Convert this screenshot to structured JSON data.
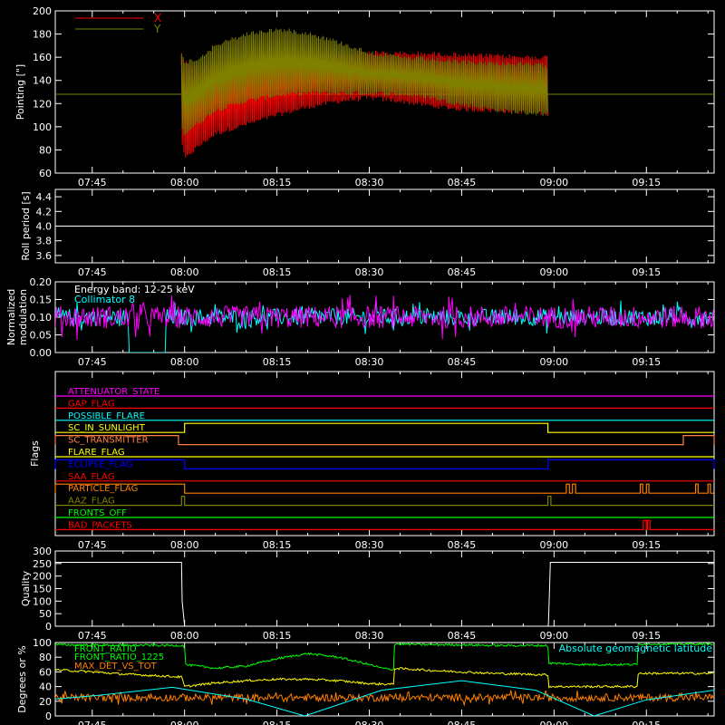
{
  "time_ticks": [
    "07:45",
    "08:00",
    "08:15",
    "08:30",
    "08:45",
    "09:00",
    "09:15"
  ],
  "time_tick_minutes": [
    465,
    480,
    495,
    510,
    525,
    540,
    555
  ],
  "time_range_minutes": [
    459,
    566
  ],
  "chart_data": [
    {
      "type": "line",
      "ylabel": "Pointing [\"]",
      "ylim": [
        60,
        200
      ],
      "yticks": [
        60,
        80,
        100,
        120,
        140,
        160,
        180,
        200
      ],
      "reference_line": 128,
      "legend": {
        "placement": "top-left"
      },
      "series": [
        {
          "name": "X",
          "color": "#ff0000",
          "envelope": {
            "t": [
              479.5,
              480,
              482,
              485,
              490,
              495,
              500,
              505,
              510,
              515,
              520,
              525,
              530,
              535,
              539
            ],
            "upper": [
              164,
              158,
              153,
              158,
              163,
              165,
              166,
              166,
              166,
              165,
              165,
              164,
              163,
              162,
              162
            ],
            "lower": [
              88,
              70,
              80,
              92,
              100,
              108,
              115,
              120,
              123,
              120,
              116,
              113,
              112,
              111,
              109
            ]
          }
        },
        {
          "name": "Y",
          "color": "#808000",
          "envelope": {
            "t": [
              479.5,
              480,
              482,
              485,
              490,
              495,
              500,
              505,
              510,
              515,
              520,
              525,
              530,
              535,
              539
            ],
            "upper": [
              164,
              158,
              160,
              172,
              182,
              186,
              183,
              175,
              166,
              162,
              160,
              158,
              157,
              156,
              155
            ],
            "lower": [
              96,
              92,
              100,
              112,
              120,
              125,
              127,
              127,
              127,
              126,
              123,
              117,
              113,
              110,
              109
            ]
          }
        }
      ]
    },
    {
      "type": "line",
      "ylabel": "Roll period [s]",
      "ylim": [
        3.5,
        4.5
      ],
      "yticks": [
        3.6,
        3.8,
        4.0,
        4.2,
        4.4
      ],
      "series": [
        {
          "color": "#ffffff",
          "x": [
            459,
            566
          ],
          "values": [
            4.0,
            4.0
          ]
        }
      ]
    },
    {
      "type": "line",
      "ylabel": "Normalized modulation",
      "ylim": [
        0.0,
        0.2
      ],
      "yticks": [
        0.0,
        0.05,
        0.1,
        0.15,
        0.2
      ],
      "annotations": [
        "Energy band: 12-25 keV",
        "Collimator 8"
      ],
      "series": [
        {
          "color": "#ff00ff",
          "baseline": 0.1,
          "spread": 0.04
        },
        {
          "color": "#00ffff",
          "baseline": 0.1,
          "spread": 0.03,
          "gap_t": [
            471,
            477
          ],
          "gap_value": 0.0
        }
      ]
    },
    {
      "type": "line",
      "ylabel": "Flags",
      "flags": [
        {
          "name": "ATTENUATOR_STATE",
          "color": "#ff00ff",
          "on": []
        },
        {
          "name": "GAP_FLAG",
          "color": "#ff0000",
          "on": []
        },
        {
          "name": "POSSIBLE_FLARE",
          "color": "#00ffff",
          "on": []
        },
        {
          "name": "SC_IN_SUNLIGHT",
          "color": "#ffff00",
          "on": [
            [
              480,
              539
            ]
          ]
        },
        {
          "name": "SC_TRANSMITTER",
          "color": "#ff8040",
          "on": [
            [
              459,
              479
            ],
            [
              561,
              566
            ]
          ]
        },
        {
          "name": "FLARE_FLAG",
          "color": "#ffff00",
          "on": []
        },
        {
          "name": "ECLIPSE_FLAG",
          "color": "#0000ff",
          "on": [
            [
              459,
              480
            ],
            [
              539,
              566
            ]
          ]
        },
        {
          "name": "SAA_FLAG",
          "color": "#ff0000",
          "on": []
        },
        {
          "name": "PARTICLE_FLAG",
          "color": "#ff8000",
          "on": [
            [
              459,
              480
            ],
            [
              542,
              542.5
            ],
            [
              543,
              543.5
            ],
            [
              554,
              554.4
            ],
            [
              555,
              555.4
            ],
            [
              563,
              563.4
            ],
            [
              565,
              565.4
            ]
          ]
        },
        {
          "name": "AAZ_FLAG",
          "color": "#808000",
          "on": [
            [
              479.5,
              480
            ],
            [
              539,
              539.5
            ]
          ]
        },
        {
          "name": "FRONTS_OFF",
          "color": "#00ff00",
          "on": []
        },
        {
          "name": "BAD_PACKETS",
          "color": "#ff0000",
          "on": [
            [
              554.5,
              555
            ],
            [
              555.2,
              555.6
            ]
          ]
        }
      ]
    },
    {
      "type": "line",
      "ylabel": "Quality",
      "ylim": [
        0,
        300
      ],
      "yticks": [
        0,
        50,
        100,
        150,
        200,
        250,
        300
      ],
      "series": [
        {
          "color": "#ffffff",
          "x": [
            459,
            479.5,
            479.6,
            480,
            539,
            539.1,
            539.4,
            566
          ],
          "values": [
            255,
            255,
            100,
            0,
            0,
            10,
            255,
            255
          ]
        }
      ]
    },
    {
      "type": "line",
      "ylabel": "Degrees or %",
      "ylim": [
        0,
        100
      ],
      "yticks": [
        0,
        20,
        40,
        60,
        80,
        100
      ],
      "series": [
        {
          "name": "FRONT_RATIO",
          "color": "#00ff00",
          "x": [
            459,
            480,
            480.1,
            485,
            490,
            495,
            500,
            505,
            510,
            512,
            514,
            514.1,
            520,
            525,
            530,
            535,
            539,
            539.1,
            545,
            550,
            553.5,
            553.6,
            566
          ],
          "values": [
            97,
            96,
            70,
            65,
            68,
            78,
            85,
            80,
            70,
            65,
            63,
            98,
            97,
            97,
            96,
            96,
            96,
            72,
            70,
            70,
            70,
            98,
            98
          ]
        },
        {
          "name": "FRONT_RATIO_1225",
          "color": "#ffff00",
          "x": [
            459,
            465,
            470,
            475,
            479.5,
            480,
            485,
            490,
            495,
            500,
            505,
            510,
            514,
            514.1,
            520,
            525,
            530,
            535,
            539,
            539.1,
            545,
            553.5,
            553.6,
            566
          ],
          "values": [
            63,
            60,
            57,
            55,
            53,
            40,
            45,
            48,
            50,
            50,
            48,
            44,
            43,
            65,
            62,
            60,
            58,
            57,
            56,
            40,
            40,
            40,
            58,
            58
          ]
        },
        {
          "name": "MAX_DET_VS_TOT",
          "color": "#ff8000",
          "baseline": 25,
          "spread": 5
        },
        {
          "name": "Absolute geomagnetic latitude",
          "color": "#00ffff",
          "x": [
            459,
            466,
            478,
            490,
            499.5,
            512,
            525,
            537,
            546.5,
            555,
            566
          ],
          "values": [
            23,
            28,
            39,
            23,
            0,
            35,
            48,
            35,
            0,
            22,
            35
          ]
        }
      ]
    }
  ]
}
